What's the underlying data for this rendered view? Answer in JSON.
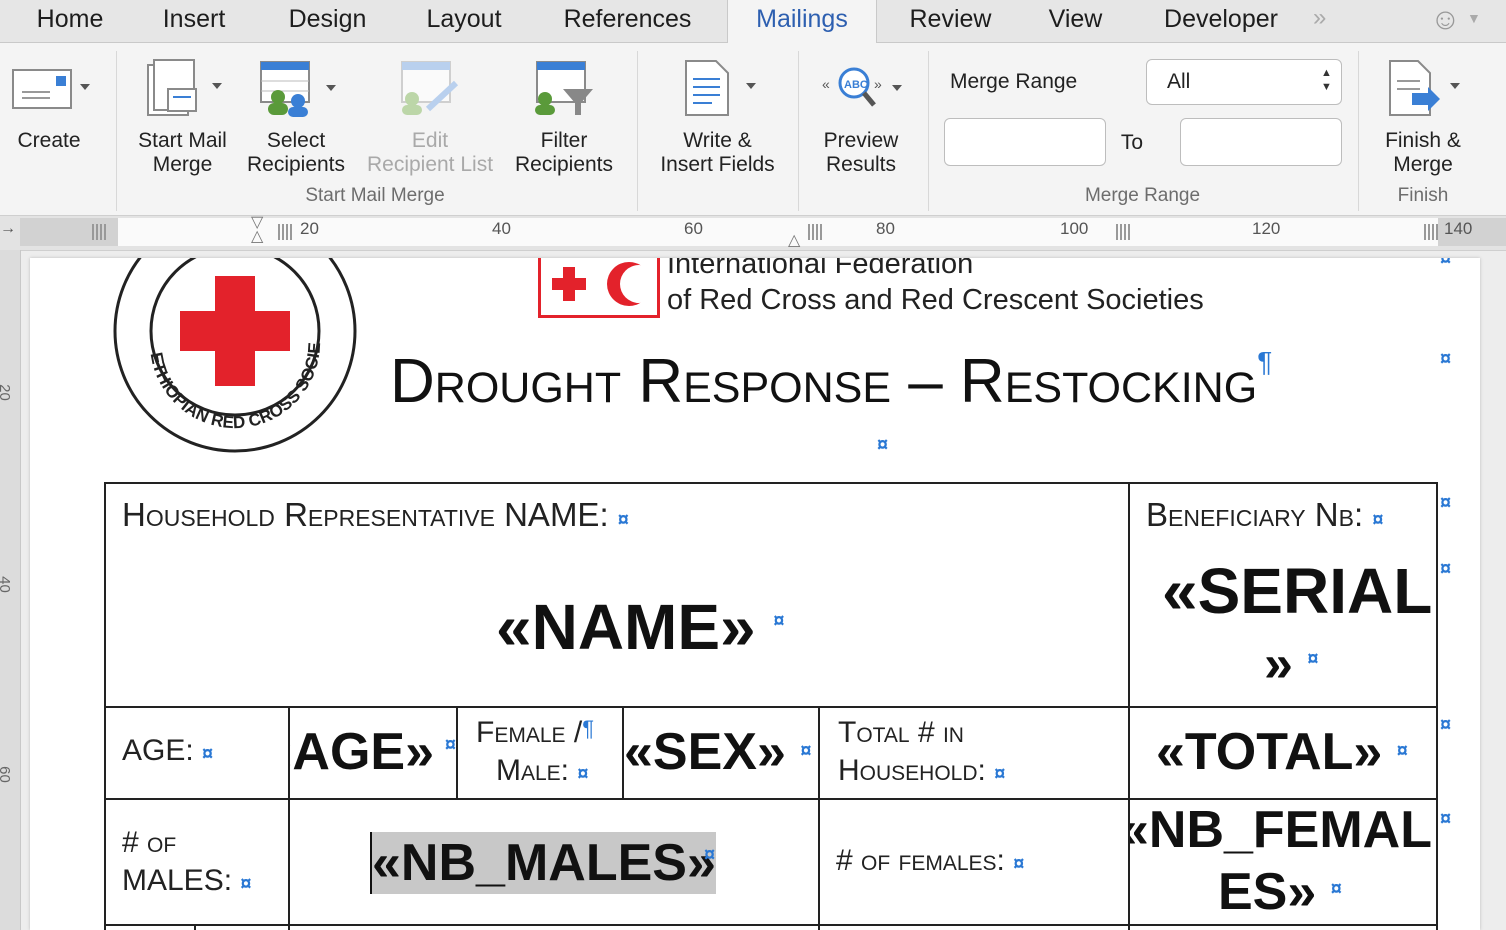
{
  "tabs": [
    "Home",
    "Insert",
    "Design",
    "Layout",
    "References",
    "Mailings",
    "Review",
    "View",
    "Developer"
  ],
  "active_tab": "Mailings",
  "ribbon": {
    "create": "Create",
    "start_mail_merge_1": "Start Mail",
    "start_mail_merge_2": "Merge",
    "select_recipients_1": "Select",
    "select_recipients_2": "Recipients",
    "edit_recipient_1": "Edit",
    "edit_recipient_2": "Recipient List",
    "filter_recipients_1": "Filter",
    "filter_recipients_2": "Recipients",
    "group_start_mail_merge": "Start Mail Merge",
    "write_insert_1": "Write &",
    "write_insert_2": "Insert Fields",
    "preview_1": "Preview",
    "preview_2": "Results",
    "merge_range_label": "Merge Range",
    "merge_range_value": "All",
    "to_label": "To",
    "group_merge_range": "Merge Range",
    "finish_1": "Finish &",
    "finish_2": "Merge",
    "group_finish": "Finish"
  },
  "ruler": [
    "20",
    "40",
    "60",
    "80",
    "100",
    "120",
    "140"
  ],
  "vruler": [
    "20",
    "40",
    "60"
  ],
  "document": {
    "logo_ring_text": "ETHIOPIAN RED CROSS SOCIETY",
    "ifrc_line1": "International Federation",
    "ifrc_line2": "of Red Cross and Red Crescent Societies",
    "title": "Drought Response – Restocking",
    "pilcrow": "¶",
    "hh_label": "Household Representative NAME:",
    "benef_label": "Beneficiary Nb:",
    "name_field": "«NAME»",
    "serial_field_1": "«SERIAL",
    "serial_field_2": "»",
    "age_label": "AGE:",
    "age_field": "«AGE»",
    "sex_label_1": "Female /",
    "sex_label_2": "Male:",
    "sex_field": "«SEX»",
    "total_label_1": "Total # in",
    "total_label_2": "Household:",
    "total_field": "«TOTAL»",
    "males_label_1": "# of",
    "males_label_2": "MALES:",
    "males_field": "«NB_MALES»",
    "females_label": "# of females:",
    "females_field_1": "«NB_FEMAL",
    "females_field_2": "ES»",
    "cell_mark": "¤"
  }
}
